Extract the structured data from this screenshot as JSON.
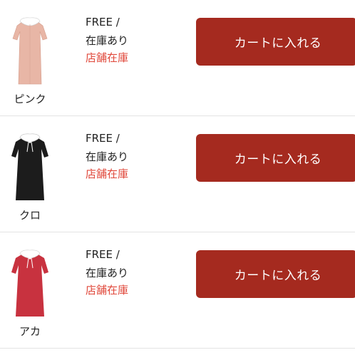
{
  "items": [
    {
      "color": "ピンク",
      "size": "FREE /",
      "stock": "在庫あり",
      "store": "店舗在庫",
      "cart_label": "カートに入れる",
      "dress_color": "#e8b6a6",
      "collar_color": "#ffffff"
    },
    {
      "color": "クロ",
      "size": "FREE /",
      "stock": "在庫あり",
      "store": "店舗在庫",
      "cart_label": "カートに入れる",
      "dress_color": "#1c1c1c",
      "collar_color": "#ffffff"
    },
    {
      "color": "アカ",
      "size": "FREE /",
      "stock": "在庫あり",
      "store": "店舗在庫",
      "cart_label": "カートに入れる",
      "dress_color": "#c8323f",
      "collar_color": "#ffffff"
    }
  ],
  "theme": {
    "button_color": "#a52a1f",
    "store_text_color": "#e0473a"
  }
}
